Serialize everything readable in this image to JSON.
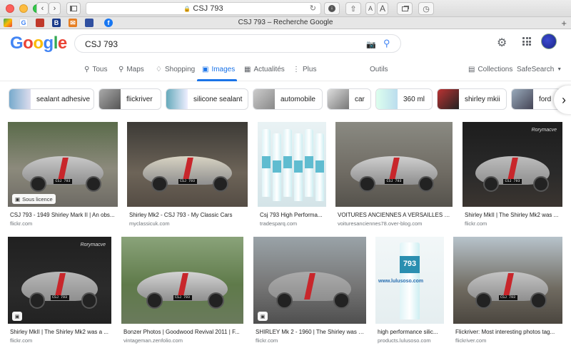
{
  "browser": {
    "address": "CSJ 793",
    "tab_title": "CSJ 793 – Recherche Google",
    "font_small_label": "A",
    "font_large_label": "A"
  },
  "google": {
    "logo": "Google",
    "query": "CSJ 793",
    "nav": {
      "tous": "Tous",
      "maps": "Maps",
      "shopping": "Shopping",
      "images": "Images",
      "actualites": "Actualités",
      "plus": "Plus",
      "outils": "Outils",
      "collections": "Collections",
      "safesearch": "SafeSearch"
    },
    "chips": [
      "sealant adhesive",
      "flickriver",
      "silicone sealant",
      "automobile",
      "car",
      "360 ml",
      "shirley mkii",
      "ford"
    ],
    "results": [
      {
        "caption": "CSJ 793 - 1949 Shirley Mark II | An obs...",
        "source": "flickr.com",
        "license": "Sous licence",
        "plate": "CSJ 793"
      },
      {
        "caption": "Shirley Mk2 - CSJ 793 - My Classic Cars",
        "source": "myclassicuk.com",
        "plate": "CSJ 793"
      },
      {
        "caption": "Csj 793 High Performa...",
        "source": "tradesparq.com"
      },
      {
        "caption": "VOITURES ANCIENNES A VERSAILLES - L'A...",
        "source": "voituresanciennes78.over-blog.com",
        "plate": "CSJ 793"
      },
      {
        "caption": "Shirley MkII | The Shirley Mk2 was ...",
        "source": "flickr.com",
        "watermark": "Rorymacve",
        "plate": "CSJ 793"
      },
      {
        "caption": "Shirley MkII | The Shirley Mk2 was a ...",
        "source": "flickr.com",
        "watermark": "Rorymacve",
        "plate": "CSJ 793"
      },
      {
        "caption": "Bonzer Photos | Goodwood Revival 2011 | F...",
        "source": "vintageman.zenfolio.com",
        "plate": "CSJ 793"
      },
      {
        "caption": "SHIRLEY Mk 2 - 1960 | The Shirley was s...",
        "source": "flickr.com"
      },
      {
        "caption": "high performance silic...",
        "source": "products.lulusoso.com",
        "label": "793",
        "watermark": "www.lulusoso.com"
      },
      {
        "caption": "Flickriver: Most interesting photos tag...",
        "source": "flickriver.com",
        "plate": "CSJ 793"
      }
    ]
  }
}
